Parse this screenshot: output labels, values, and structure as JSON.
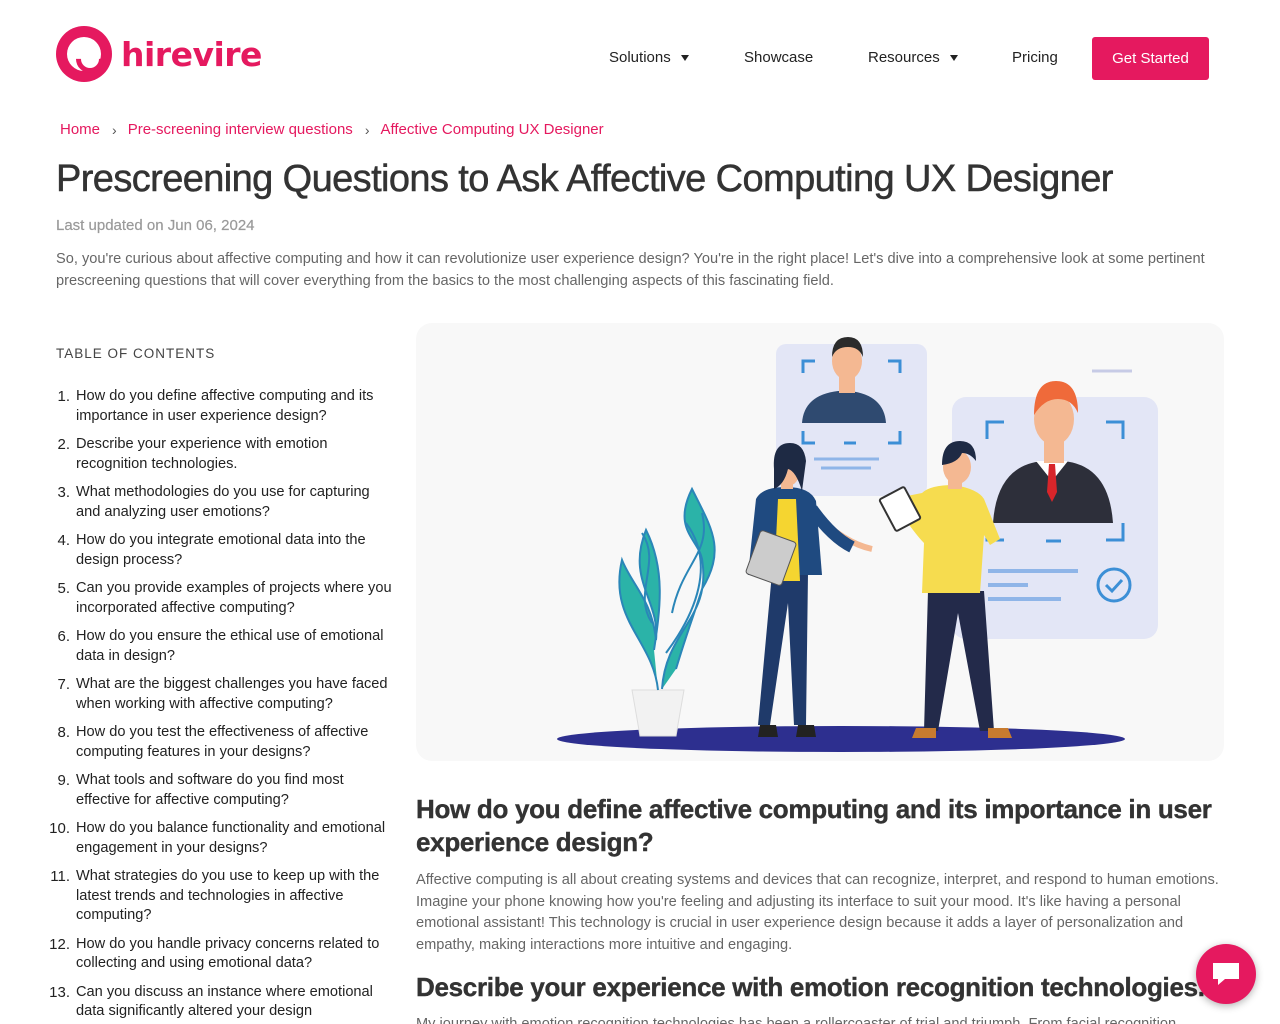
{
  "brand": {
    "name": "hirevire",
    "color": "#e5195f"
  },
  "nav": {
    "items": [
      {
        "label": "Solutions",
        "dropdown": true
      },
      {
        "label": "Showcase",
        "dropdown": false
      },
      {
        "label": "Resources",
        "dropdown": true
      },
      {
        "label": "Pricing",
        "dropdown": false
      }
    ],
    "cta": "Get Started"
  },
  "breadcrumb": [
    "Home",
    "Pre-screening interview questions",
    "Affective Computing UX Designer"
  ],
  "title": "Prescreening Questions to Ask Affective Computing UX Designer",
  "updated": "Last updated on Jun 06, 2024",
  "intro": "So, you're curious about affective computing and how it can revolutionize user experience design? You're in the right place! Let's dive into a comprehensive look at some pertinent prescreening questions that will cover everything from the basics to the most challenging aspects of this fascinating field.",
  "toc": {
    "title": "TABLE OF CONTENTS",
    "items": [
      {
        "num": "1.",
        "text": "How do you define affective computing and its importance in user experience design?"
      },
      {
        "num": "2.",
        "text": "Describe your experience with emotion recognition technologies."
      },
      {
        "num": "3.",
        "text": "What methodologies do you use for capturing and analyzing user emotions?"
      },
      {
        "num": "4.",
        "text": "How do you integrate emotional data into the design process?"
      },
      {
        "num": "5.",
        "text": "Can you provide examples of projects where you incorporated affective computing?"
      },
      {
        "num": "6.",
        "text": "How do you ensure the ethical use of emotional data in design?"
      },
      {
        "num": "7.",
        "text": "What are the biggest challenges you have faced when working with affective computing?"
      },
      {
        "num": "8.",
        "text": "How do you test the effectiveness of affective computing features in your designs?"
      },
      {
        "num": "9.",
        "text": "What tools and software do you find most effective for affective computing?"
      },
      {
        "num": "10.",
        "text": "How do you balance functionality and emotional engagement in your designs?"
      },
      {
        "num": "11.",
        "text": "What strategies do you use to keep up with the latest trends and technologies in affective computing?"
      },
      {
        "num": "12.",
        "text": "How do you handle privacy concerns related to collecting and using emotional data?"
      },
      {
        "num": "13.",
        "text": "Can you discuss an instance where emotional data significantly altered your design"
      }
    ]
  },
  "sections": [
    {
      "heading": "How do you define affective computing and its importance in user experience design?",
      "body": "Affective computing is all about creating systems and devices that can recognize, interpret, and respond to human emotions. Imagine your phone knowing how you're feeling and adjusting its interface to suit your mood. It's like having a personal emotional assistant! This technology is crucial in user experience design because it adds a layer of personalization and empathy, making interactions more intuitive and engaging."
    },
    {
      "heading": "Describe your experience with emotion recognition technologies.",
      "body": "My journey with emotion recognition technologies has been a rollercoaster of trial and triumph. From facial recognition"
    }
  ],
  "icons": {
    "chat": "chat-bubble-icon",
    "breadcrumb_separator": "chevron-right-icon",
    "dropdown": "caret-down-icon"
  }
}
